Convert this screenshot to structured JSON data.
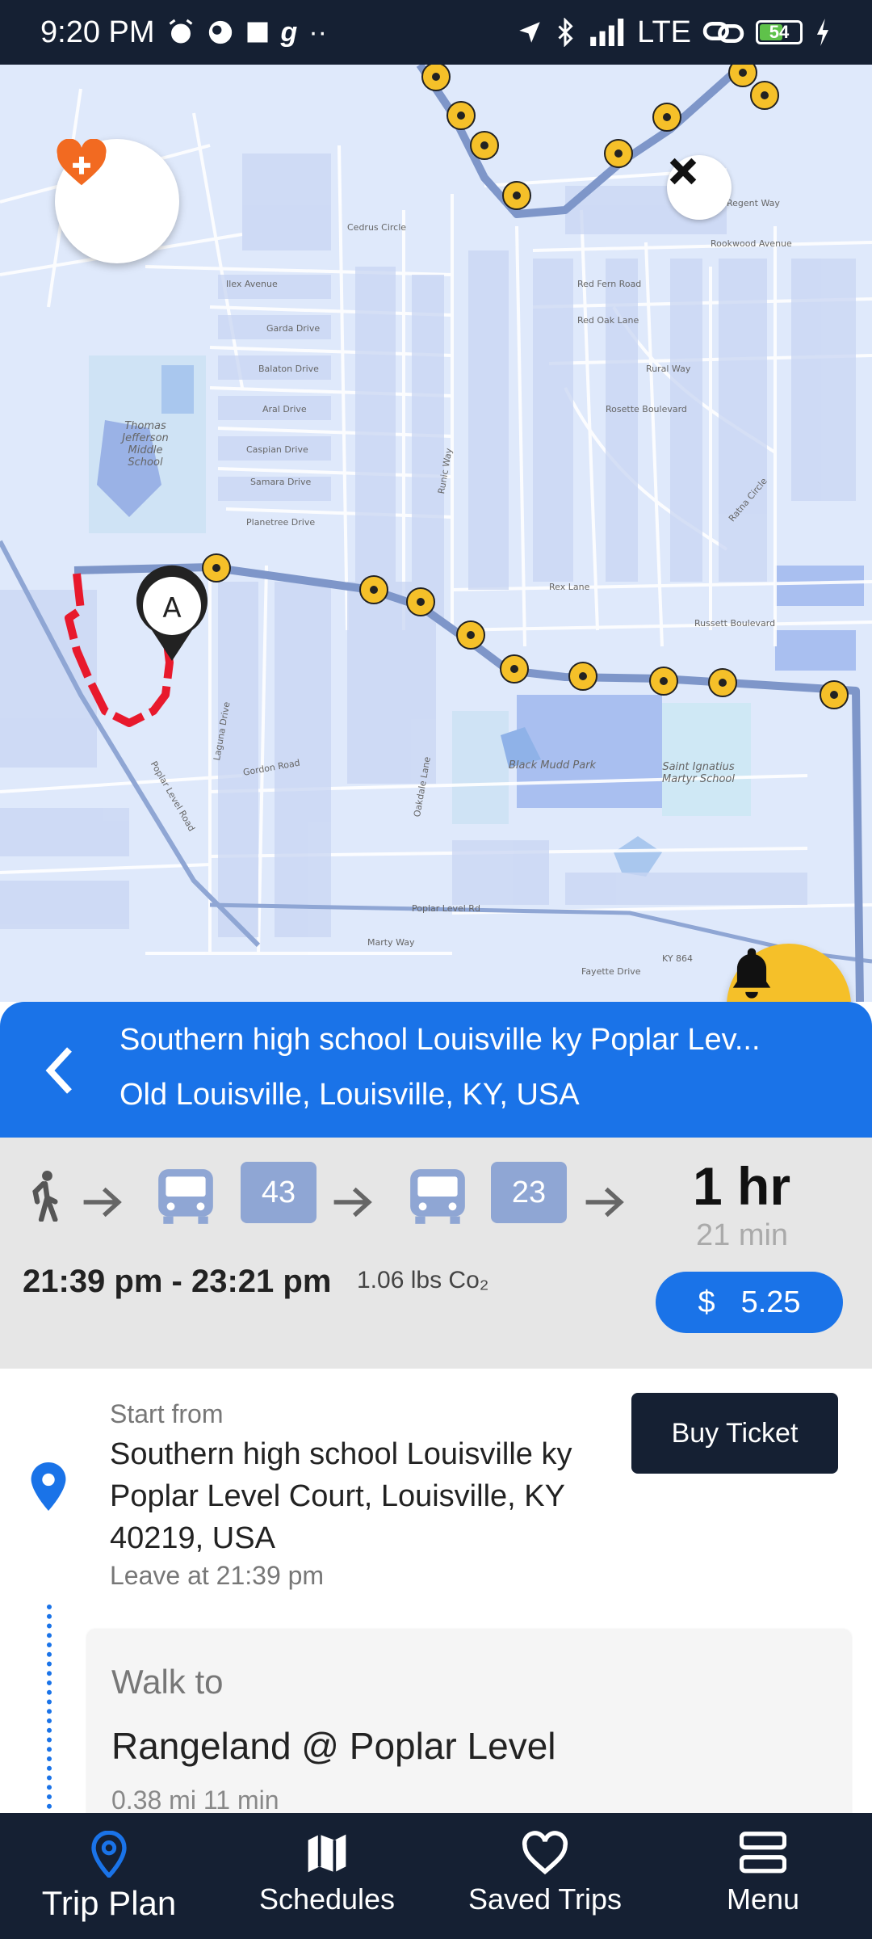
{
  "status_bar": {
    "time": "9:20 PM",
    "network": "LTE",
    "battery": "54"
  },
  "map": {
    "marker_label": "A",
    "labels": [
      "Thomas Jefferson Middle School",
      "Black Mudd Park",
      "Saint Ignatius Martyr School",
      "Poplar Level Road",
      "Russett Boulevard",
      "Rex Lane",
      "Oakdale Lane",
      "Planetree Drive",
      "Gordon Road",
      "Red Oak Lane",
      "Rural Way",
      "Rookwood Avenue",
      "Regent Way",
      "Ilex Avenue",
      "Cedrus Circle",
      "Caspian Drive",
      "Aral Drive",
      "Balaton Drive",
      "Garda Drive",
      "Samara Drive",
      "Rosette Boulevard",
      "Runic Way",
      "Red Fern Road",
      "Poplar Level Rd",
      "KY 864",
      "Marty Way",
      "Fayette Drive",
      "Ratna Circle",
      "Laguna Drive"
    ]
  },
  "header": {
    "title": "Southern high school Louisville ky  Poplar Lev...",
    "subtitle": "Old Louisville, Louisville, KY, USA"
  },
  "summary": {
    "routes": [
      "43",
      "23"
    ],
    "duration_hr": "1 hr",
    "duration_min": "21 min",
    "time_range": "21:39 pm - 23:21 pm",
    "co2": "1.06 lbs Co₂",
    "fare_currency": "$",
    "fare": "5.25"
  },
  "details": {
    "start_label": "Start from",
    "start_address": "Southern high school Louisville ky Poplar Level Court, Louisville, KY 40219, USA",
    "leave_at": "Leave at  21:39 pm",
    "buy_ticket": "Buy Ticket",
    "walk_label": "Walk to",
    "walk_destination": "Rangeland @ Poplar Level",
    "walk_meta": "0.38  mi   11 min"
  },
  "nav": {
    "items": [
      "Trip Plan",
      "Schedules",
      "Saved Trips",
      "Menu"
    ]
  },
  "colors": {
    "primary": "#1a73e8",
    "dark": "#152033",
    "accent": "#f5c029",
    "walk_route": "#e8192c"
  }
}
